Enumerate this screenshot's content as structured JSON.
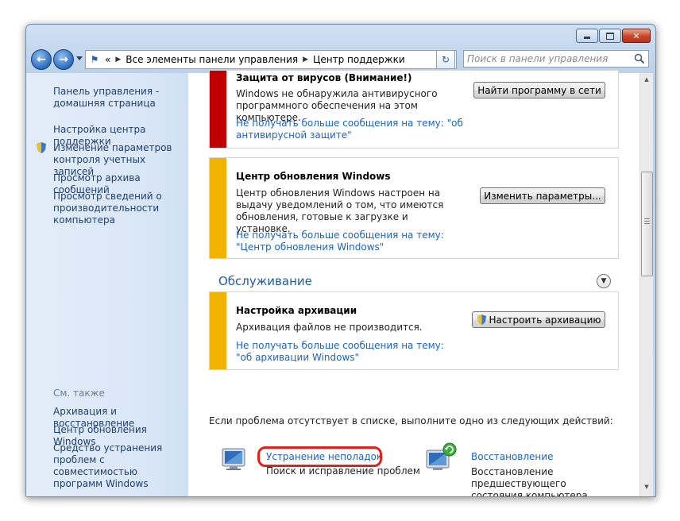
{
  "window": {
    "breadcrumb_overflow": "«",
    "breadcrumb": [
      "Все элементы панели управления",
      "Центр поддержки"
    ],
    "search_placeholder": "Поиск в панели управления"
  },
  "sidebar": {
    "home_link": "Панель управления - домашняя страница",
    "links": [
      "Настройка центра поддержки",
      "Изменение параметров контроля учетных записей",
      "Просмотр архива сообщений",
      "Просмотр сведений о производительности компьютера"
    ],
    "see_also_heading": "См. также",
    "see_also": [
      "Архивация и восстановление",
      "Центр обновления Windows",
      "Средство устранения проблем с совместимостью программ Windows"
    ]
  },
  "main": {
    "virus": {
      "title": "Защита от вирусов  (Внимание!)",
      "text": "Windows не обнаружила антивирусного программного обеспечения на этом компьютере.",
      "link": "Не получать больше сообщения на тему: \"об антивирусной защите\"",
      "button": "Найти программу в сети",
      "color": "#c00000"
    },
    "update": {
      "title": "Центр обновления Windows",
      "text": "Центр обновления Windows настроен на выдачу уведомлений о том, что имеются обновления, готовые к загрузке и установке.",
      "link": "Не получать больше сообщения на тему: \"Центр обновления Windows\"",
      "button": "Изменить параметры...",
      "color": "#f0b400"
    },
    "maintenance_title": "Обслуживание",
    "backup": {
      "title": "Настройка архивации",
      "text": "Архивация файлов не производится.",
      "link": "Не получать больше сообщения на тему: \"об архивации Windows\"",
      "button": "Настроить архивацию",
      "color": "#f0b400"
    },
    "hint": "Если проблема отсутствует в списке, выполните одно из следующих действий:",
    "troubleshoot": {
      "link": "Устранение неполадок",
      "desc": "Поиск и исправление проблем"
    },
    "restore": {
      "link": "Восстановление",
      "desc": "Восстановление предшествующего состояния компьютера"
    }
  }
}
